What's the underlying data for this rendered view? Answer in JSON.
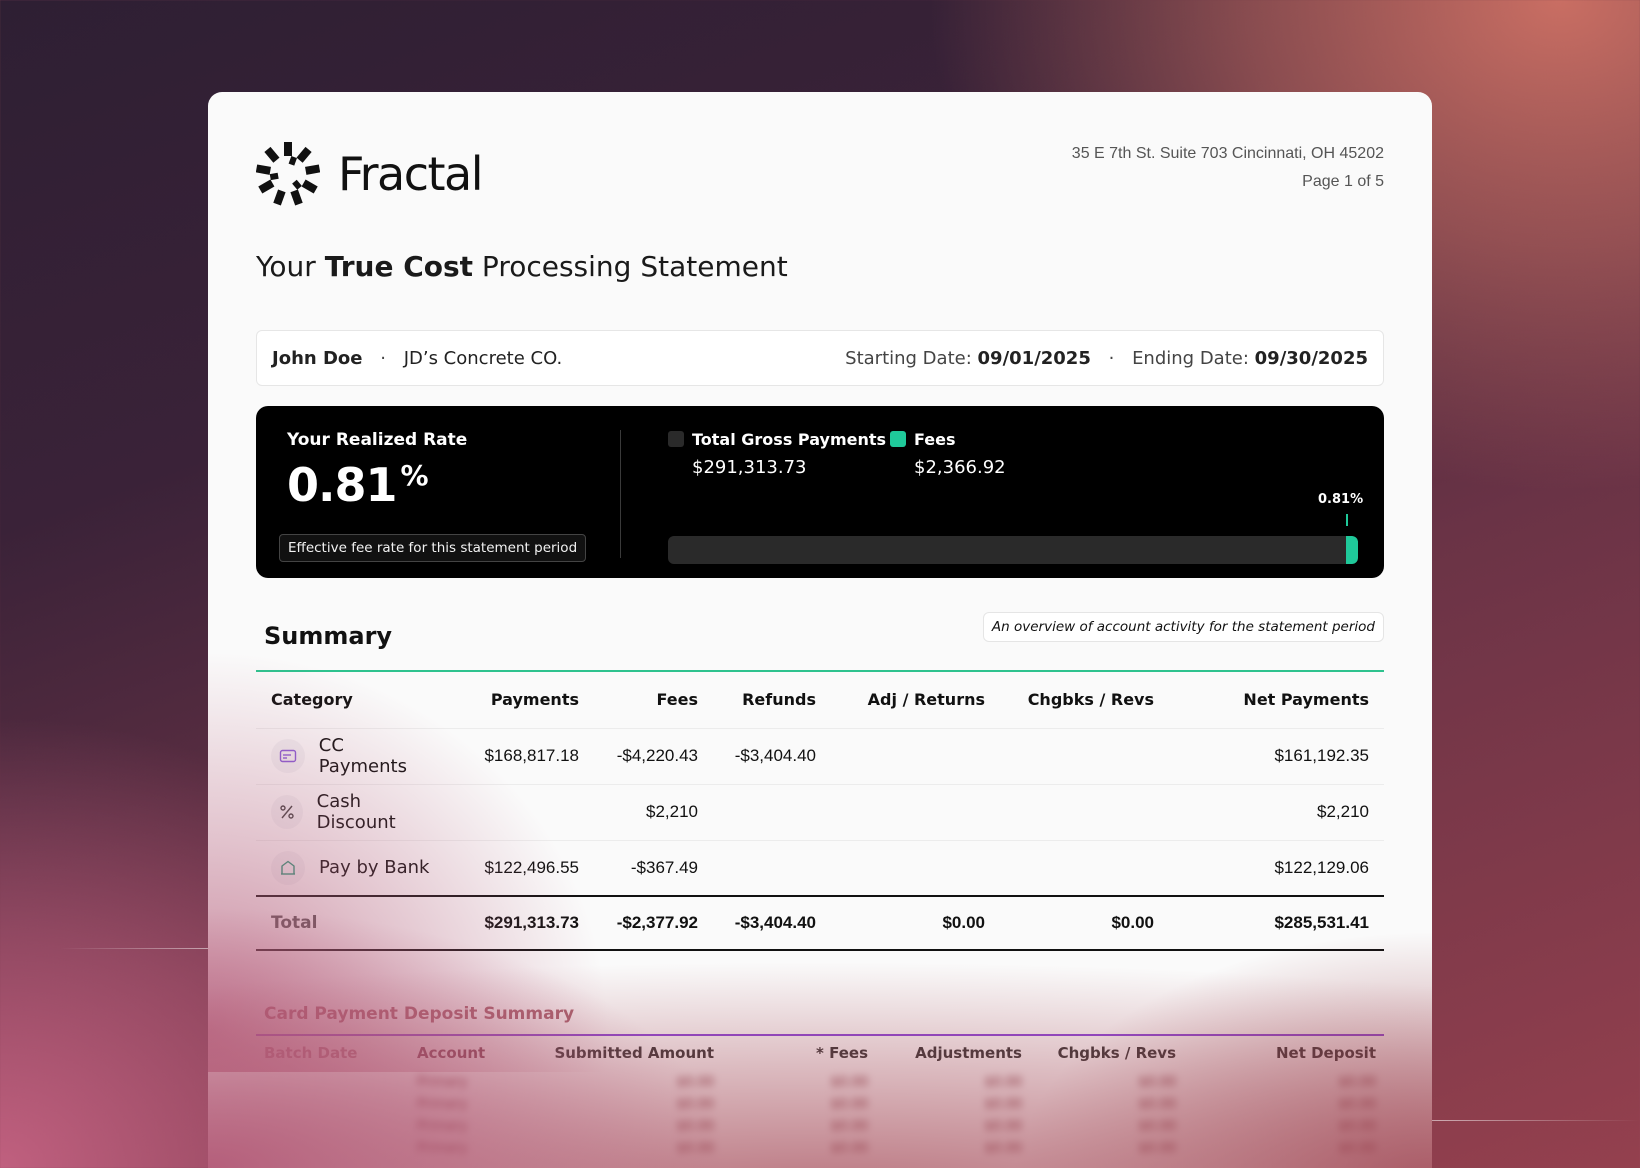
{
  "brand": {
    "name": "Fractal"
  },
  "header": {
    "address": "35 E 7th St. Suite 703 Cincinnati, OH 45202",
    "page": "Page 1 of 5"
  },
  "title": {
    "prefix": "Your ",
    "bold": "True Cost",
    "suffix": " Processing Statement"
  },
  "info": {
    "name": "John Doe",
    "company": "JD’s Concrete CO.",
    "start_label": "Starting Date:",
    "start_date": "09/01/2025",
    "end_label": "Ending Date:",
    "end_date": "09/30/2025",
    "separator": "·"
  },
  "rate": {
    "label": "Your Realized Rate",
    "value": "0.81",
    "unit": "%",
    "note": "Effective fee rate for this statement period",
    "legend": [
      {
        "name": "Total Gross Payments",
        "amount": "$291,313.73",
        "color": "#2a2a2a"
      },
      {
        "name": "Fees",
        "amount": "$2,366.92",
        "color": "#1fc99a"
      }
    ],
    "bar": {
      "fee_fraction": 0.0081,
      "marker_label": "0.81%"
    }
  },
  "summary": {
    "title": "Summary",
    "description": "An overview of account activity for the statement period",
    "columns": [
      "Category",
      "Payments",
      "Fees",
      "Refunds",
      "Adj / Returns",
      "Chgbks / Revs",
      "Net Payments"
    ],
    "rows": [
      {
        "icon": "credit-card-icon",
        "category": "CC Payments",
        "payments": "$168,817.18",
        "fees": "-$4,220.43",
        "refunds": "-$3,404.40",
        "adj": "",
        "chgbks": "",
        "net": "$161,192.35"
      },
      {
        "icon": "percent-icon",
        "category": "Cash Discount",
        "payments": "",
        "fees": "$2,210",
        "refunds": "",
        "adj": "",
        "chgbks": "",
        "net": "$2,210"
      },
      {
        "icon": "bank-icon",
        "category": "Pay by Bank",
        "payments": "$122,496.55",
        "fees": "-$367.49",
        "refunds": "",
        "adj": "",
        "chgbks": "",
        "net": "$122,129.06"
      }
    ],
    "total": {
      "category": "Total",
      "payments": "$291,313.73",
      "fees": "-$2,377.92",
      "refunds": "-$3,404.40",
      "adj": "$0.00",
      "chgbks": "$0.00",
      "net": "$285,531.41"
    }
  },
  "card_deposit": {
    "title": "Card Payment Deposit Summary",
    "columns": [
      "Batch Date",
      "Account",
      "Submitted Amount",
      "* Fees",
      "Adjustments",
      "Chgbks / Revs",
      "Net Deposit"
    ],
    "rows": [
      [
        "Primary",
        "$0.00",
        "$0.00",
        "$0.00",
        "$0.00",
        "$0.00"
      ],
      [
        "Primary",
        "$0.00",
        "$0.00",
        "$0.00",
        "$0.00",
        "$0.00"
      ],
      [
        "Primary",
        "$0.00",
        "$0.00",
        "$0.00",
        "$0.00",
        "$0.00"
      ],
      [
        "Primary",
        "$0.00",
        "$0.00",
        "$0.00",
        "$0.00",
        "$0.00"
      ]
    ]
  }
}
